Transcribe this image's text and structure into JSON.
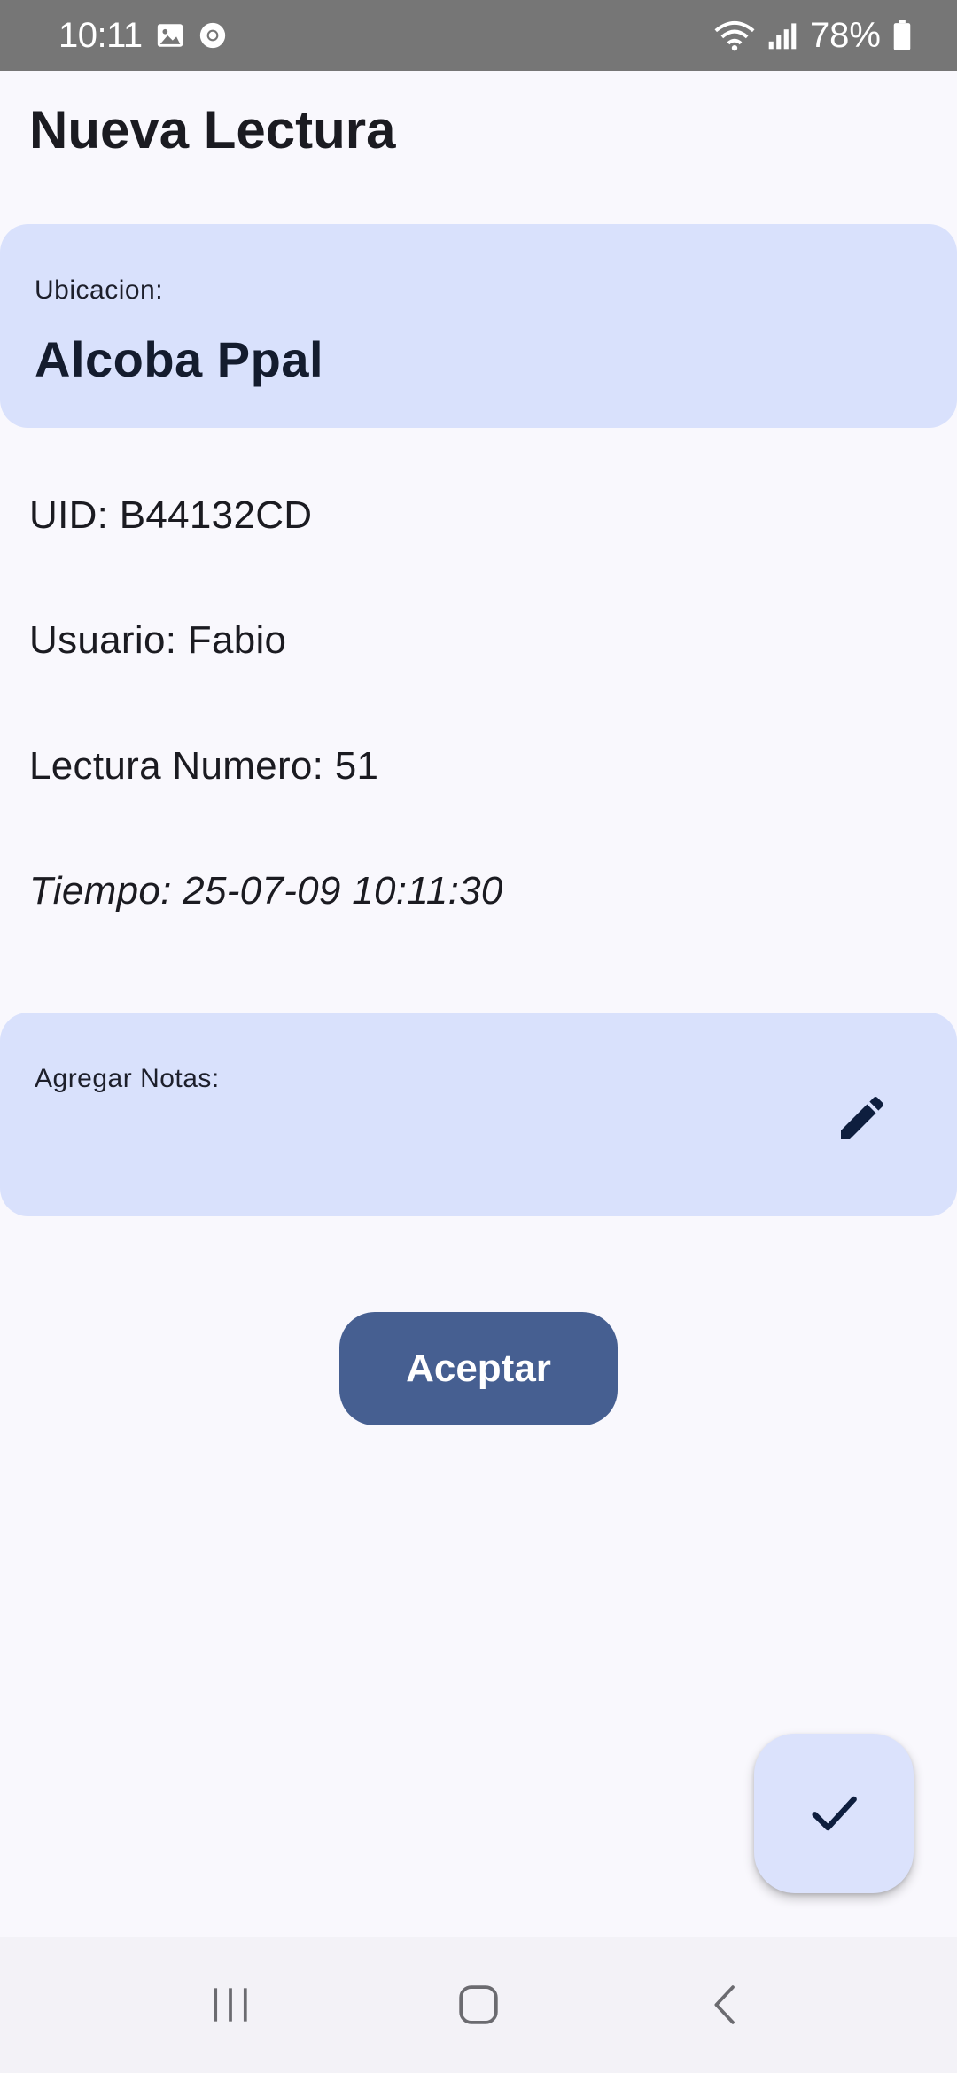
{
  "status_bar": {
    "time": "10:11",
    "battery": "78%",
    "icons": [
      "gallery-icon",
      "chrome-icon",
      "wifi-icon",
      "signal-icon",
      "battery-icon"
    ]
  },
  "header": {
    "title": "Nueva Lectura"
  },
  "location": {
    "label": "Ubicacion:",
    "value": "Alcoba Ppal"
  },
  "details": {
    "uid": "UID: B44132CD",
    "user": "Usuario: Fabio",
    "reading_number": "Lectura Numero: 51",
    "time": "Tiempo: 25-07-09 10:11:30"
  },
  "notes": {
    "label": "Agregar Notas:",
    "edit_icon": "pencil-icon"
  },
  "actions": {
    "accept_label": "Aceptar",
    "fab_icon": "check-icon"
  },
  "navigation": {
    "buttons": [
      "recent-apps-icon",
      "home-icon",
      "back-icon"
    ]
  },
  "colors": {
    "card_bg": "#d9e1fc",
    "primary": "#465f91",
    "status_bar": "#767676",
    "page_bg": "#f9f8fd"
  }
}
